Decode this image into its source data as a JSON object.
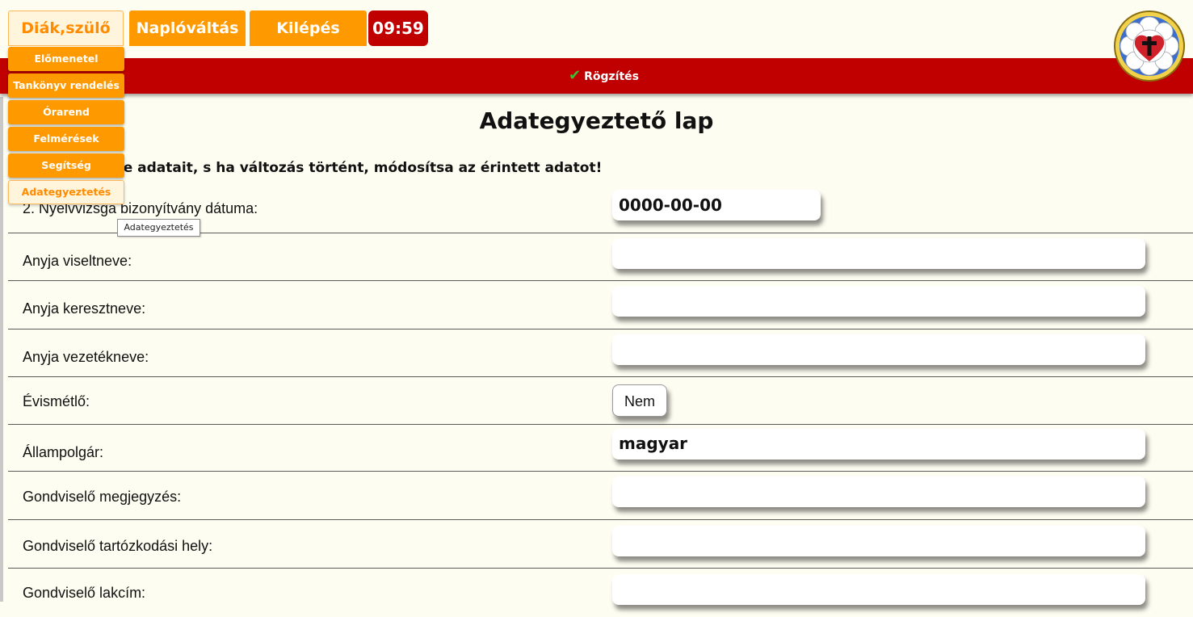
{
  "header": {
    "tabs": [
      {
        "label": "Diák,szülő"
      },
      {
        "label": "Naplóváltás"
      },
      {
        "label": "Kilépés"
      }
    ],
    "timer": "09:59"
  },
  "toolbar": {
    "save_label": "Rögzítés"
  },
  "menu": {
    "items": [
      {
        "label": "Előmenetel"
      },
      {
        "label": "Tankönyv rendelés"
      },
      {
        "label": "Órarend"
      },
      {
        "label": "Felmérések"
      },
      {
        "label": "Segítség"
      },
      {
        "label": "Adategyeztetés"
      }
    ],
    "tooltip": "Adategyeztetés"
  },
  "page": {
    "title": "Adategyeztető lap",
    "instruction": "rizze gyermeke adatait, s ha változás történt, módosítsa az érintett adatot!"
  },
  "form": {
    "rows": [
      {
        "label": "2. Nyelvvizsga bizonyítvány dátuma:",
        "value": "0000-00-00"
      },
      {
        "label": "Anyja viseltneve:",
        "value": ""
      },
      {
        "label": "Anyja keresztneve:",
        "value": ""
      },
      {
        "label": "Anyja vezetékneve:",
        "value": ""
      },
      {
        "label": "Évismétlő:",
        "value": "Nem"
      },
      {
        "label": "Állampolgár:",
        "value": "magyar"
      },
      {
        "label": "Gondviselő megjegyzés:",
        "value": ""
      },
      {
        "label": "Gondviselő tartózkodási hely:",
        "value": ""
      },
      {
        "label": "Gondviselő lakcím:",
        "value": ""
      }
    ]
  }
}
